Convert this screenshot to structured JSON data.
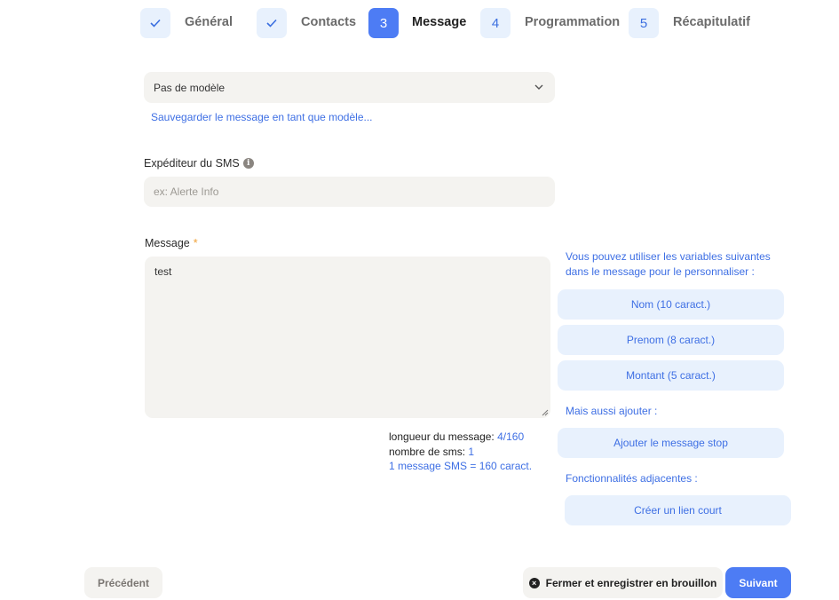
{
  "stepper": {
    "steps": [
      {
        "badge": "✓",
        "label": "Général",
        "state": "done"
      },
      {
        "badge": "✓",
        "label": "Contacts",
        "state": "done"
      },
      {
        "badge": "3",
        "label": "Message",
        "state": "active"
      },
      {
        "badge": "4",
        "label": "Programmation",
        "state": "pending"
      },
      {
        "badge": "5",
        "label": "Récapitulatif",
        "state": "pending"
      }
    ]
  },
  "template": {
    "selected": "Pas de modèle",
    "save_link": "Sauvegarder le message en tant que modèle..."
  },
  "sender": {
    "label": "Expéditeur du SMS",
    "info_glyph": "i",
    "placeholder": "ex: Alerte Info",
    "value": ""
  },
  "message": {
    "label": "Message",
    "required_mark": "*",
    "value": "test",
    "length_label": "longueur du message:",
    "length_value": "4/160",
    "sms_count_label": "nombre de sms:",
    "sms_count_value": "1",
    "sms_rule": "1 message SMS = 160 caract."
  },
  "variables": {
    "hint": "Vous pouvez utiliser les variables suivantes dans le message pour le personnaliser :",
    "items": [
      "Nom (10 caract.)",
      "Prenom (8 caract.)",
      "Montant (5 caract.)"
    ],
    "also_hint": "Mais aussi ajouter :",
    "stop_button": "Ajouter le message stop",
    "features_hint": "Fonctionnalités adjacentes :",
    "short_link_button": "Créer un lien court"
  },
  "footer": {
    "previous": "Précédent",
    "draft": "Fermer et enregistrer en brouillon",
    "draft_icon": "×",
    "next": "Suivant"
  },
  "colors": {
    "accent": "#4d7cf4",
    "link": "#3e6fe4",
    "chip_bg": "#e8f1fd",
    "field_bg": "#f4f3f0",
    "required": "#f0a23a"
  }
}
